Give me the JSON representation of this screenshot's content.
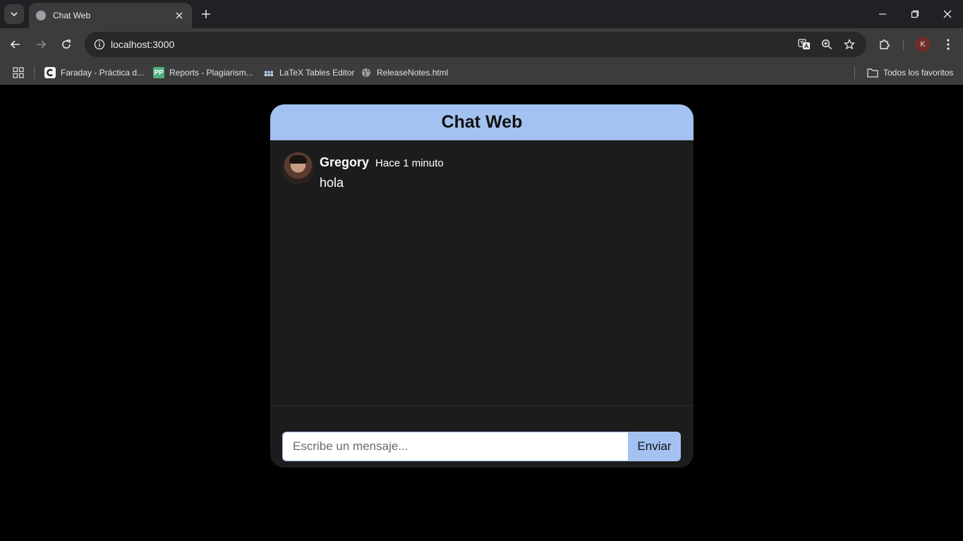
{
  "browser": {
    "tab": {
      "title": "Chat Web"
    },
    "url": "localhost:3000",
    "profile_initial": "K",
    "bookmarks": [
      {
        "label": "Faraday - Práctica d...",
        "icon": "faraday-icon"
      },
      {
        "label": "Reports - Plagiarism...",
        "icon": "pp-icon"
      },
      {
        "label": "LaTeX Tables Editor",
        "icon": "latex-icon"
      },
      {
        "label": "ReleaseNotes.html",
        "icon": "globe-icon"
      }
    ],
    "all_bookmarks_label": "Todos los favoritos"
  },
  "chat": {
    "title": "Chat Web",
    "messages": [
      {
        "user": "Gregory",
        "time": "Hace 1 minuto",
        "text": "hola"
      }
    ],
    "input_placeholder": "Escribe un mensaje...",
    "send_label": "Enviar"
  },
  "colors": {
    "accent": "#a3c2f1",
    "panel": "#1c1c1d",
    "background": "#000000"
  }
}
